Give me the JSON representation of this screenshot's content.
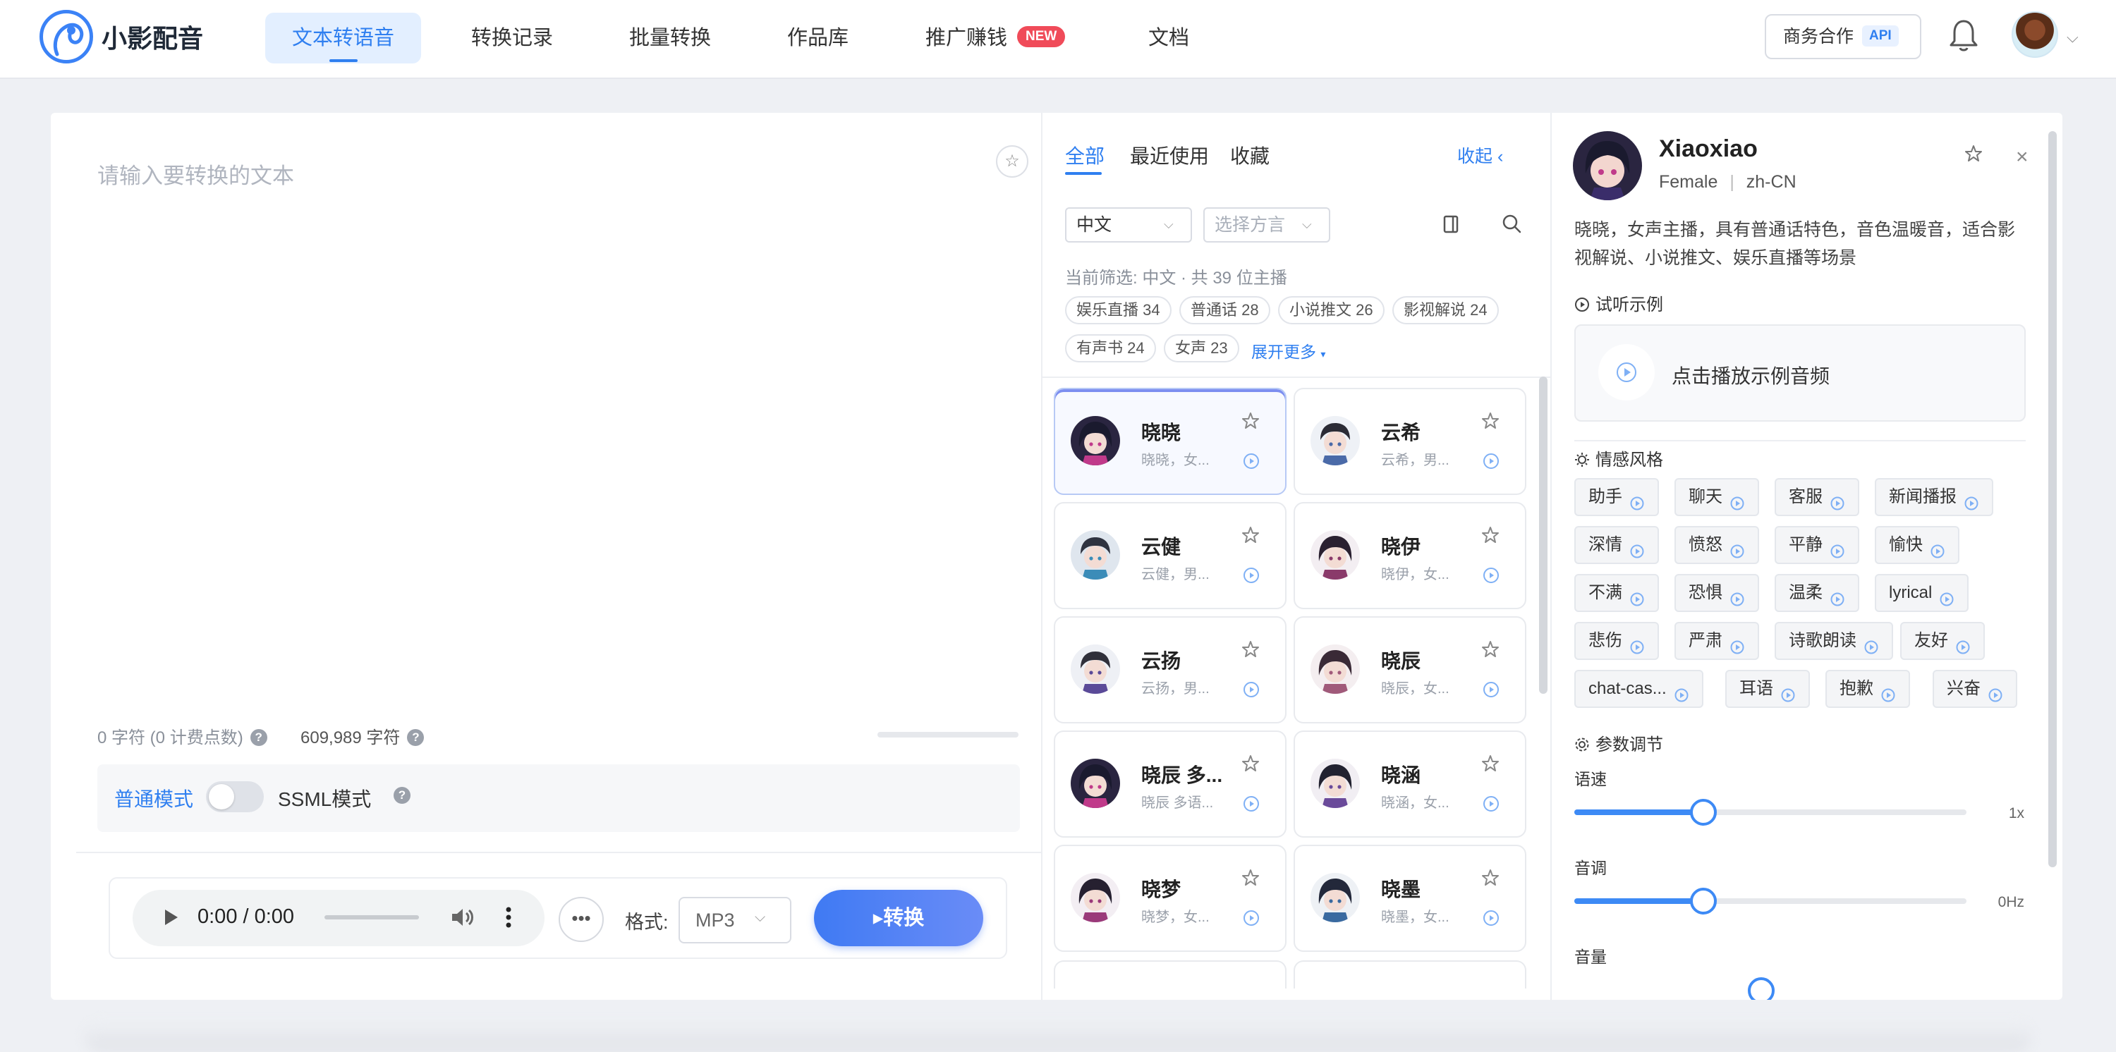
{
  "app": {
    "name": "小影配音"
  },
  "nav": {
    "items": [
      "文本转语音",
      "转换记录",
      "批量转换",
      "作品库",
      "推广赚钱",
      "文档"
    ],
    "new_badge": "NEW",
    "active_index": 0
  },
  "header": {
    "business_label": "商务合作",
    "api_badge": "API"
  },
  "editor": {
    "placeholder": "请输入要转换的文本",
    "char_count": "0 字符 (0 计费点数)",
    "char_total": "609,989 字符",
    "mode_normal": "普通模式",
    "mode_ssml": "SSML模式"
  },
  "player": {
    "time": "0:00 / 0:00",
    "format_label": "格式:",
    "format_value": "MP3",
    "convert_label": "转换"
  },
  "voice_list": {
    "tabs": [
      "全部",
      "最近使用",
      "收藏"
    ],
    "collapse_label": "收起",
    "language_value": "中文",
    "dialect_placeholder": "选择方言",
    "filter_summary": "当前筛选: 中文 · 共 39 位主播",
    "tags": [
      "娱乐直播 34",
      "普通话 28",
      "小说推文 26",
      "影视解说 24",
      "有声书 24",
      "女声 23"
    ],
    "expand_more": "展开更多",
    "voices": [
      {
        "name": "晓晓",
        "desc": "晓晓，女..."
      },
      {
        "name": "云希",
        "desc": "云希，男..."
      },
      {
        "name": "云健",
        "desc": "云健，男..."
      },
      {
        "name": "晓伊",
        "desc": "晓伊，女..."
      },
      {
        "name": "云扬",
        "desc": "云扬，男..."
      },
      {
        "name": "晓辰",
        "desc": "晓辰，女..."
      },
      {
        "name": "晓辰 多...",
        "desc": "晓辰 多语..."
      },
      {
        "name": "晓涵",
        "desc": "晓涵，女..."
      },
      {
        "name": "晓梦",
        "desc": "晓梦，女..."
      },
      {
        "name": "晓墨",
        "desc": "晓墨，女..."
      }
    ]
  },
  "detail": {
    "name": "Xiaoxiao",
    "gender": "Female",
    "locale": "zh-CN",
    "meta_sep": "|",
    "description": "晓晓，女声主播，具有普通话特色，音色温暖音，适合影视解说、小说推文、娱乐直播等场景",
    "sample_heading": "试听示例",
    "sample_text": "点击播放示例音频",
    "emotion_heading": "情感风格",
    "emotions": [
      "助手",
      "聊天",
      "客服",
      "新闻播报",
      "深情",
      "愤怒",
      "平静",
      "愉快",
      "不满",
      "恐惧",
      "温柔",
      "lyrical",
      "悲伤",
      "严肃",
      "诗歌朗读",
      "友好",
      "chat-cas...",
      "耳语",
      "抱歉",
      "兴奋"
    ],
    "params_heading": "参数调节",
    "params": [
      {
        "label": "语速",
        "value_text": "1x",
        "level": 0.33
      },
      {
        "label": "音调",
        "value_text": "0Hz",
        "level": 0.33
      },
      {
        "label": "音量"
      }
    ]
  },
  "colors": {
    "accent": "#2f7ff0",
    "new_badge": "#f04b59",
    "convert_start": "#3f7af3",
    "convert_end": "#6a8cf7"
  }
}
